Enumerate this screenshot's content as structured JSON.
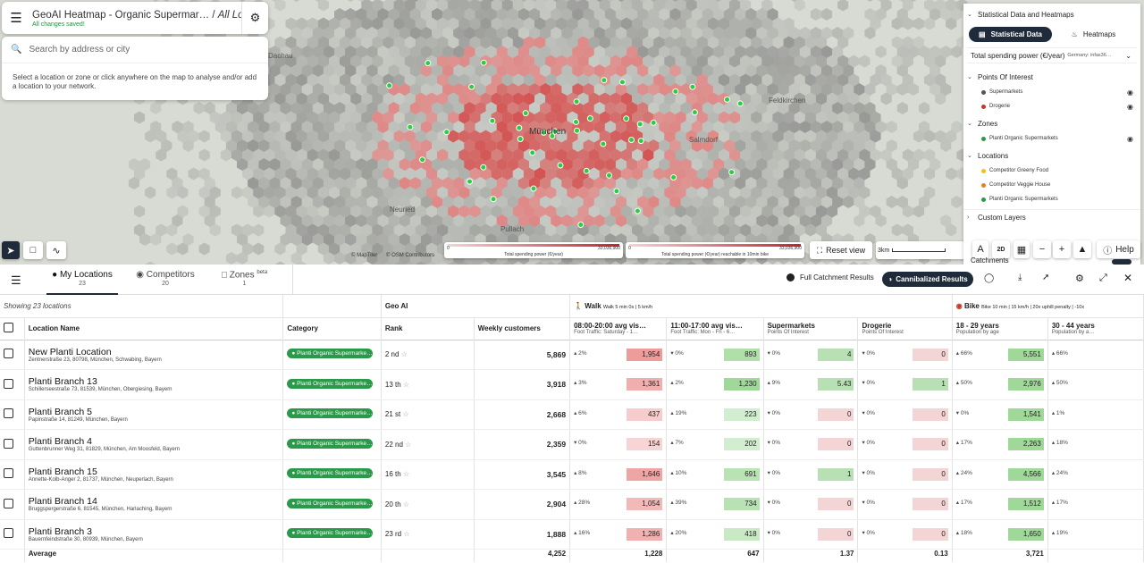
{
  "header": {
    "project_title": "GeoAI Heatmap - Organic Supermar…",
    "slash": "/",
    "view_name": "All Loca…",
    "saved_status": "All changes saved!"
  },
  "search": {
    "placeholder": "Search by address or city",
    "hint": "Select a location or zone or click anywhere on the map to analyse and/or add a location to your network."
  },
  "map": {
    "city_label": "München",
    "place_labels": [
      "Dachau",
      "Feldkirchen",
      "Salmdorf",
      "Pullach",
      "Neuried"
    ],
    "attribution_mapbox": "© MapTiler",
    "attribution_osm": "© OSM Contributors",
    "legend1": {
      "min": "0",
      "max": "33,036,900",
      "label": "Total spending power (€/year)"
    },
    "legend2": {
      "min": "0",
      "max": "33,036,900",
      "label": "Total spending power (€/year) reachable in 10min bike"
    },
    "reset_label": "Reset view",
    "scale_label": "3km",
    "mode_2d": "2D",
    "help_label": "Help"
  },
  "right_panel": {
    "stat_title": "Statistical Data and Heatmaps",
    "tab_stat": "Statistical Data",
    "tab_heat": "Heatmaps",
    "select_value": "Total spending power (€/year)",
    "select_source": "Germany: infas36…",
    "poi_title": "Points Of Interest",
    "poi_items": [
      {
        "label": "Supermarkets",
        "color": "#555"
      },
      {
        "label": "Drogerie",
        "color": "#c0392b"
      }
    ],
    "zones_title": "Zones",
    "zone_items": [
      {
        "label": "Planti Organic Supermarkets",
        "color": "#2a9a4a"
      }
    ],
    "locations_title": "Locations",
    "location_items": [
      {
        "label": "Competitor Greeny Food",
        "color": "#f1c40f"
      },
      {
        "label": "Competitor Veggie House",
        "color": "#e67e22"
      },
      {
        "label": "Planti Organic Supermarkets",
        "color": "#2a9a4a"
      }
    ],
    "custom_title": "Custom Layers",
    "catchments_label": "Catchments"
  },
  "tabs": {
    "my_locations": "My Locations",
    "my_locations_count": "23",
    "competitors": "Competitors",
    "competitors_count": "20",
    "zones": "Zones",
    "zones_badge": "beta",
    "zones_count": "1"
  },
  "toolbar": {
    "full_results": "Full Catchment Results",
    "cannibalized": "Cannibalized Results"
  },
  "table": {
    "showing": "Showing 23 locations",
    "group_geo": "Geo AI",
    "group_walk": "Walk",
    "group_walk_sub": "Walk 5 min 0s | 5 km/h",
    "group_bike": "Bike",
    "group_bike_sub": "Bike 10 min | 15 km/h | 20x uphill penalty | -10x",
    "col_name": "Location Name",
    "col_category": "Category",
    "col_rank": "Rank",
    "col_weekly": "Weekly customers",
    "metrics": [
      {
        "title": "08:00-20:00 avg vis…",
        "sub": "Foot Traffic: Saturday - 1…"
      },
      {
        "title": "11:00-17:00 avg vis…",
        "sub": "Foot Traffic: Mon - Fri - 6…"
      },
      {
        "title": "Supermarkets",
        "sub": "Points Of Interest"
      },
      {
        "title": "Drogerie",
        "sub": "Points Of Interest"
      },
      {
        "title": "18 - 29 years",
        "sub": "Population by age"
      },
      {
        "title": "30 - 44 years",
        "sub": "Population by a…"
      }
    ],
    "rows": [
      {
        "name": "New Planti Location",
        "addr": "Zentnerstraße 23, 80798, München, Schwabing, Bayern",
        "category": "Planti Organic Supermarke…",
        "rank": "2 nd",
        "weekly": "5,869",
        "m": [
          [
            "2%",
            "1,954"
          ],
          [
            "0%",
            "893"
          ],
          [
            "0%",
            "4"
          ],
          [
            "0%",
            "0"
          ],
          [
            "66%",
            "5,551"
          ],
          [
            "66%",
            ""
          ]
        ]
      },
      {
        "name": "Planti Branch 13",
        "addr": "Schillerseestraße 73, 81539, München, Obergiesing, Bayern",
        "category": "Planti Organic Supermarke…",
        "rank": "13 th",
        "weekly": "3,918",
        "m": [
          [
            "3%",
            "1,361"
          ],
          [
            "2%",
            "1,230"
          ],
          [
            "9%",
            "5.43"
          ],
          [
            "0%",
            "1"
          ],
          [
            "50%",
            "2,976"
          ],
          [
            "50%",
            ""
          ]
        ]
      },
      {
        "name": "Planti Branch 5",
        "addr": "Papinstraße 14, 81249, München, Bayern",
        "category": "Planti Organic Supermarke…",
        "rank": "21 st",
        "weekly": "2,668",
        "m": [
          [
            "6%",
            "437"
          ],
          [
            "19%",
            "223"
          ],
          [
            "0%",
            "0"
          ],
          [
            "0%",
            "0"
          ],
          [
            "0%",
            "1,541"
          ],
          [
            "1%",
            ""
          ]
        ]
      },
      {
        "name": "Planti Branch 4",
        "addr": "Guttenbrunner Weg 31, 81829, München, Am Moosfeld, Bayern",
        "category": "Planti Organic Supermarke…",
        "rank": "22 nd",
        "weekly": "2,359",
        "m": [
          [
            "0%",
            "154"
          ],
          [
            "7%",
            "202"
          ],
          [
            "0%",
            "0"
          ],
          [
            "0%",
            "0"
          ],
          [
            "17%",
            "2,263"
          ],
          [
            "18%",
            ""
          ]
        ]
      },
      {
        "name": "Planti Branch 15",
        "addr": "Annette-Kolb-Anger 2, 81737, München, Neuperlach, Bayern",
        "category": "Planti Organic Supermarke…",
        "rank": "16 th",
        "weekly": "3,545",
        "m": [
          [
            "8%",
            "1,646"
          ],
          [
            "10%",
            "691"
          ],
          [
            "0%",
            "1"
          ],
          [
            "0%",
            "0"
          ],
          [
            "24%",
            "4,566"
          ],
          [
            "24%",
            ""
          ]
        ]
      },
      {
        "name": "Planti Branch 14",
        "addr": "Bruggspergerstraße 6, 81545, München, Harlaching, Bayern",
        "category": "Planti Organic Supermarke…",
        "rank": "20 th",
        "weekly": "2,904",
        "m": [
          [
            "28%",
            "1,054"
          ],
          [
            "39%",
            "734"
          ],
          [
            "0%",
            "0"
          ],
          [
            "0%",
            "0"
          ],
          [
            "17%",
            "1,512"
          ],
          [
            "17%",
            ""
          ]
        ]
      },
      {
        "name": "Planti Branch 3",
        "addr": "Bauernfeindstraße 30, 80939, München, Bayern",
        "category": "Planti Organic Supermarke…",
        "rank": "23 rd",
        "weekly": "1,888",
        "m": [
          [
            "16%",
            "1,286"
          ],
          [
            "20%",
            "418"
          ],
          [
            "0%",
            "0"
          ],
          [
            "0%",
            "0"
          ],
          [
            "18%",
            "1,650"
          ],
          [
            "19%",
            ""
          ]
        ]
      }
    ],
    "avg_label": "Average",
    "avg_weekly": "4,252",
    "avg_vals": [
      "1,228",
      "647",
      "1.37",
      "0.13",
      "3,721"
    ]
  }
}
